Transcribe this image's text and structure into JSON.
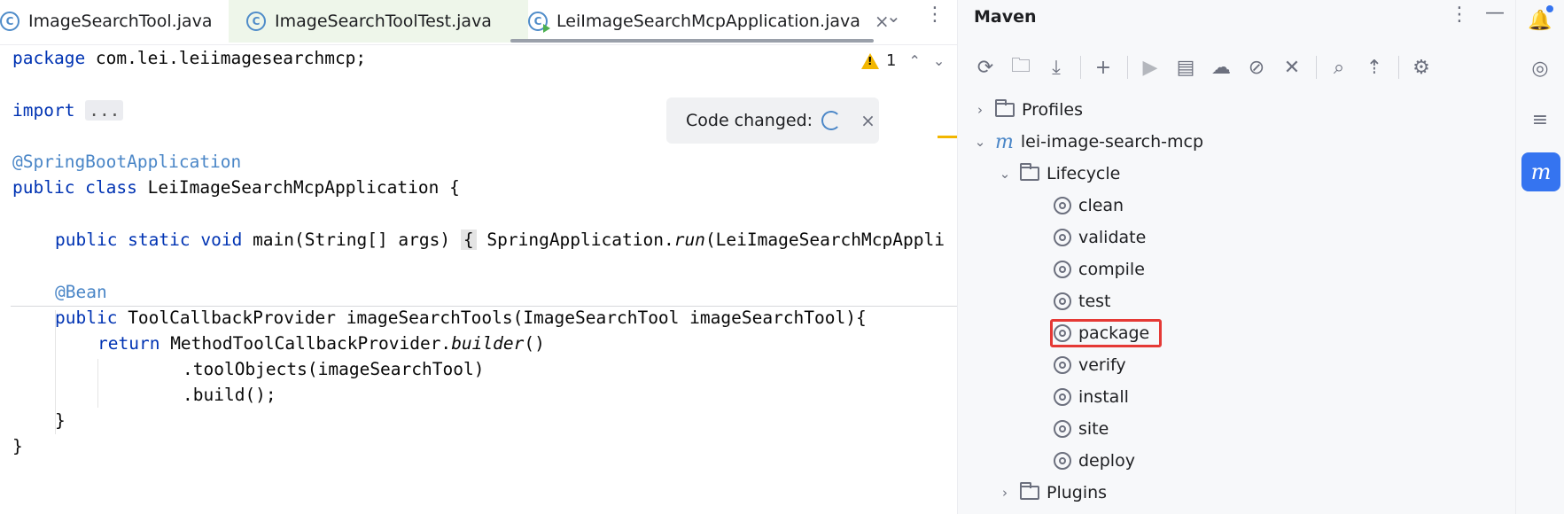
{
  "tabs": [
    {
      "label": "ImageSearchTool.java",
      "icon": "java-class-icon"
    },
    {
      "label": "ImageSearchToolTest.java",
      "icon": "java-test-class-icon"
    },
    {
      "label": "LeiImageSearchMcpApplication.java",
      "icon": "java-run-class-icon",
      "active": true
    }
  ],
  "tab_close_symbol": "×",
  "tab_more_symbol": "⌄",
  "tab_menu_symbol": "⋮",
  "code": {
    "l1_kw": "package",
    "l1_rest": " com.lei.leiimagesearchmcp;",
    "l2_kw": "import",
    "l2_fold": "...",
    "l3_ann": "@SpringBootApplication",
    "l4_kw": "public class",
    "l4_rest": " LeiImageSearchMcpApplication {",
    "l5_kw": "public static void",
    "l5_rest": " main(String[] args)",
    "l5_brace": "{",
    "l5_call": " SpringApplication.",
    "l5_run": "run",
    "l5_tail": "(LeiImageSearchMcpAppli",
    "l6_ann": "@Bean",
    "l7_kw": "public",
    "l7_rest": " ToolCallbackProvider imageSearchTools(ImageSearchTool imageSearchTool){",
    "l8_kw": "return",
    "l8_rest": " MethodToolCallbackProvider.",
    "l8_builder": "builder",
    "l8_tail": "()",
    "l9": ".toolObjects(imageSearchTool)",
    "l10": ".build();",
    "l11": "}",
    "l12": "}"
  },
  "warnings": {
    "count": "1",
    "up": "⌃",
    "down": "⌄"
  },
  "notification": {
    "text": "Code changed:",
    "close": "×"
  },
  "maven": {
    "title": "Maven",
    "menu_symbol": "⋮",
    "minimize_symbol": "—",
    "toolbar": [
      {
        "name": "reload-icon",
        "glyph": "⟳"
      },
      {
        "name": "reload-folder-icon",
        "glyph": "🗀"
      },
      {
        "name": "download-icon",
        "glyph": "⤓"
      },
      {
        "name": "add-icon",
        "glyph": "+"
      },
      {
        "name": "run-icon",
        "glyph": "▶"
      },
      {
        "name": "run-config-icon",
        "glyph": "▤"
      },
      {
        "name": "offline-icon",
        "glyph": "☁"
      },
      {
        "name": "skip-tests-icon",
        "glyph": "⊘"
      },
      {
        "name": "collapse-icon",
        "glyph": "✕"
      },
      {
        "name": "analyze-icon",
        "glyph": "⌕"
      },
      {
        "name": "show-dependencies-icon",
        "glyph": "⇡"
      },
      {
        "name": "settings-icon",
        "glyph": "⚙"
      }
    ],
    "tree": {
      "profiles": "Profiles",
      "project": "lei-image-search-mcp",
      "lifecycle": "Lifecycle",
      "phases": [
        "clean",
        "validate",
        "compile",
        "test",
        "package",
        "verify",
        "install",
        "site",
        "deploy"
      ],
      "plugins": "Plugins",
      "highlighted": "package"
    },
    "expanded_arrow": "⌄",
    "collapsed_arrow": "›"
  },
  "strip": {
    "notifications_glyph": "🔔",
    "ai_glyph": "◎",
    "database_glyph": "≡",
    "maven_glyph": "m"
  },
  "colors": {
    "accent": "#3574f0",
    "highlight": "#e53935",
    "keyword": "#0033b3",
    "annotation": "#4a86c7"
  }
}
